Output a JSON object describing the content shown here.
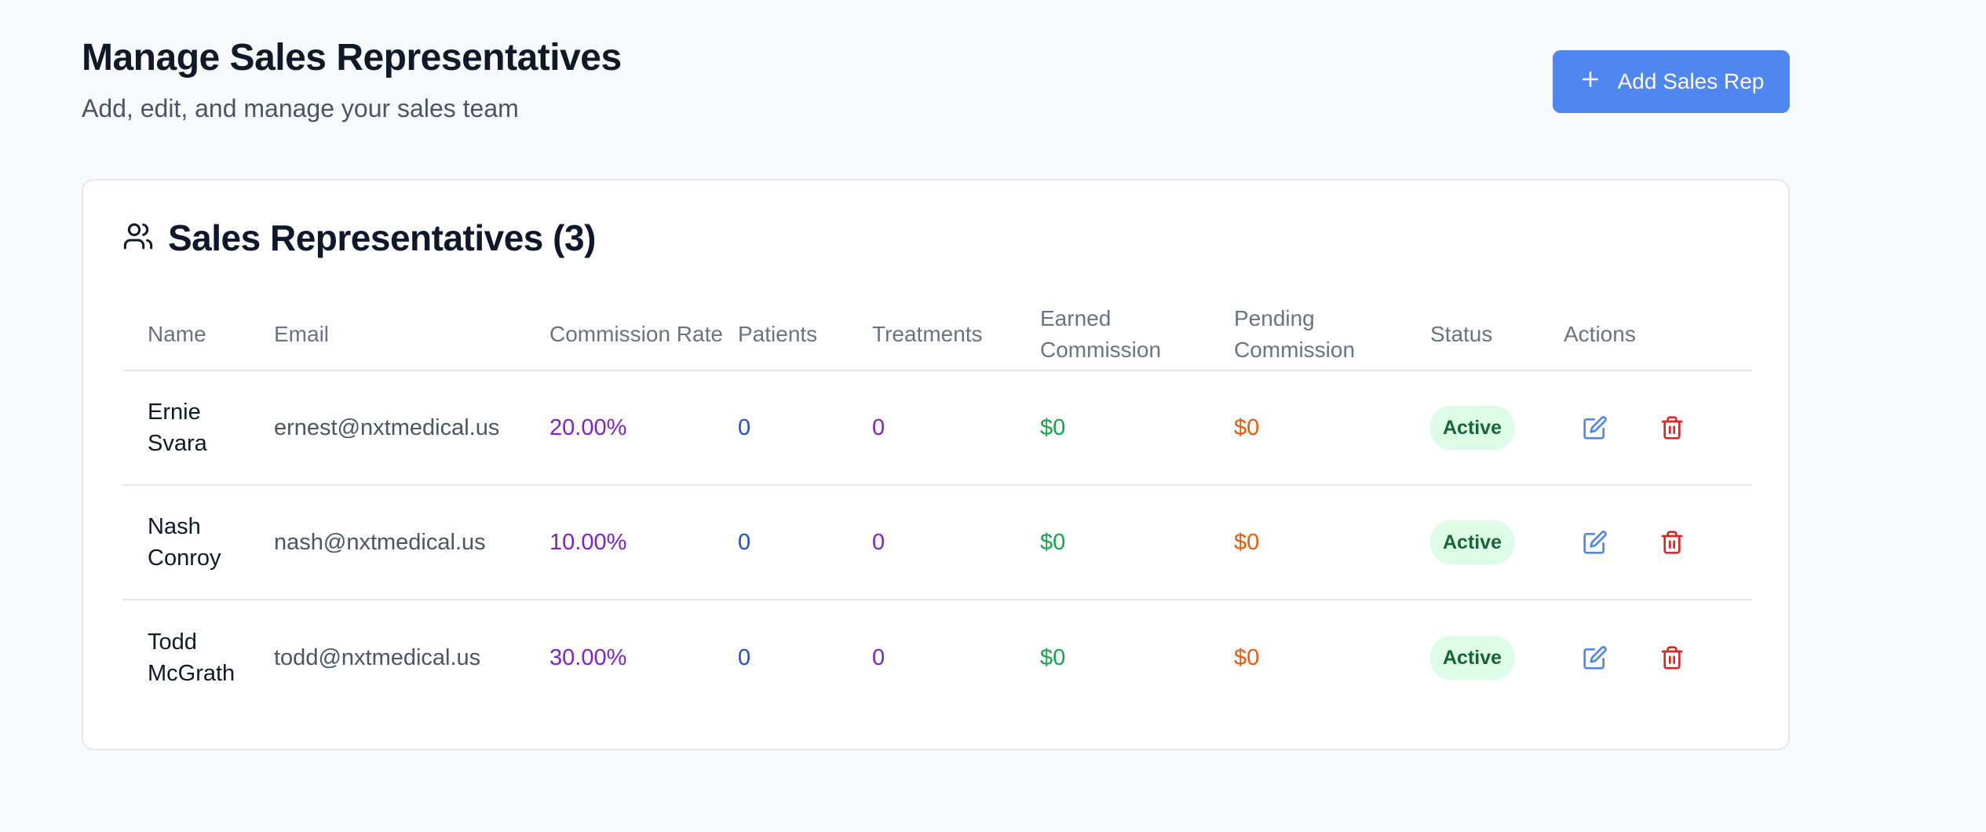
{
  "header": {
    "title": "Manage Sales Representatives",
    "subtitle": "Add, edit, and manage your sales team",
    "add_button_label": "Add Sales Rep"
  },
  "card": {
    "title": "Sales Representatives (3)"
  },
  "table": {
    "columns": [
      "Name",
      "Email",
      "Commission Rate",
      "Patients",
      "Treatments",
      "Earned Commission",
      "Pending Commission",
      "Status",
      "Actions"
    ],
    "rows": [
      {
        "name": "Ernie\nSvara",
        "email": "ernest@nxtmedical.us",
        "commission_rate": "20.00%",
        "patients": "0",
        "treatments": "0",
        "earned": "$0",
        "pending": "$0",
        "status": "Active"
      },
      {
        "name": "Nash\nConroy",
        "email": "nash@nxtmedical.us",
        "commission_rate": "10.00%",
        "patients": "0",
        "treatments": "0",
        "earned": "$0",
        "pending": "$0",
        "status": "Active"
      },
      {
        "name": "Todd\nMcGrath",
        "email": "todd@nxtmedical.us",
        "commission_rate": "30.00%",
        "patients": "0",
        "treatments": "0",
        "earned": "$0",
        "pending": "$0",
        "status": "Active"
      }
    ]
  },
  "icons": {
    "add": "plus-icon",
    "card_header": "users-icon",
    "edit": "edit-icon",
    "delete": "trash-icon"
  },
  "colors": {
    "primary_button": "#4f86f0",
    "commission_rate": "#7e22ce",
    "patients": "#1d4ed8",
    "treatments": "#7e22ce",
    "earned": "#16a34a",
    "pending": "#ea580c",
    "status_bg": "#dcfce7",
    "status_text": "#166534",
    "edit_icon": "#4f86f0",
    "delete_icon": "#dc2626"
  }
}
